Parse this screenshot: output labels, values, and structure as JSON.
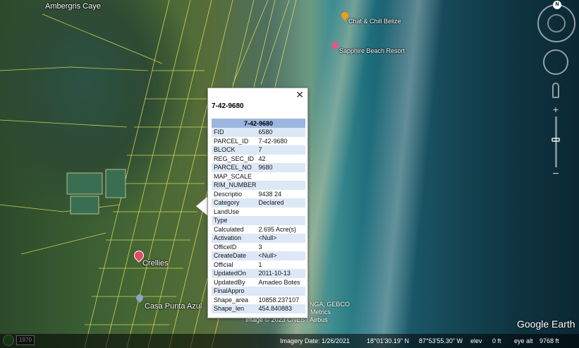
{
  "map": {
    "places": [
      {
        "name": "Ambergris Caye"
      },
      {
        "name": "Chat & Chill Belize"
      },
      {
        "name": "Sapphire Beach Resort"
      },
      {
        "name": "Crellies"
      },
      {
        "name": "Casa Punta Azul"
      }
    ],
    "credits": {
      "line1": "y, NGA, GEBCO",
      "line2": "Metrics",
      "line3": "Image © 2023 CNES / Airbus"
    },
    "brand": "Google Earth"
  },
  "controls": {
    "compass_letter": "N",
    "zoom_in": "+",
    "zoom_out": "−"
  },
  "balloon": {
    "title": "7-42-9680",
    "table_header": "7-42-9680",
    "rows": [
      {
        "key": "FID",
        "value": "6580"
      },
      {
        "key": "PARCEL_ID",
        "value": "7-42-9680"
      },
      {
        "key": "BLOCK",
        "value": "7"
      },
      {
        "key": "REG_SEC_ID",
        "value": "42"
      },
      {
        "key": "PARCEL_NO",
        "value": "9680"
      },
      {
        "key": "MAP_SCALE",
        "value": ""
      },
      {
        "key": "RIM_NUMBER",
        "value": ""
      },
      {
        "key": "Descriptio",
        "value": "9438 24"
      },
      {
        "key": "Category",
        "value": "Declared"
      },
      {
        "key": "LandUse",
        "value": ""
      },
      {
        "key": "Type",
        "value": ""
      },
      {
        "key": "Calculated",
        "value": "2.695 Acre(s)"
      },
      {
        "key": "Activation",
        "value": "<Null>"
      },
      {
        "key": "OfficeID",
        "value": "3"
      },
      {
        "key": "CreateDate",
        "value": "<Null>"
      },
      {
        "key": "Official",
        "value": "1"
      },
      {
        "key": "UpdatedOn",
        "value": "2011-10-13"
      },
      {
        "key": "UpdatedBy",
        "value": "Amadeo Botes"
      },
      {
        "key": "FinalAppro",
        "value": ""
      },
      {
        "key": "Shape_area",
        "value": "10858.237107"
      },
      {
        "key": "Shape_len",
        "value": "454.840883"
      }
    ],
    "close_glyph": "✕"
  },
  "status": {
    "year": "1970",
    "imagery_date": "Imagery Date: 1/26/2021",
    "lat": "18°01'30.19\" N",
    "lon": "87°53'55.30\" W",
    "elev_label": "elev",
    "elev_value": "0 ft",
    "eye_alt_label": "eye alt",
    "eye_alt_value": "9768 ft"
  },
  "colors": {
    "parcel_lines": "#e8e85a",
    "table_header": "#9cb6e0",
    "row_alt": "#dde8f6"
  }
}
